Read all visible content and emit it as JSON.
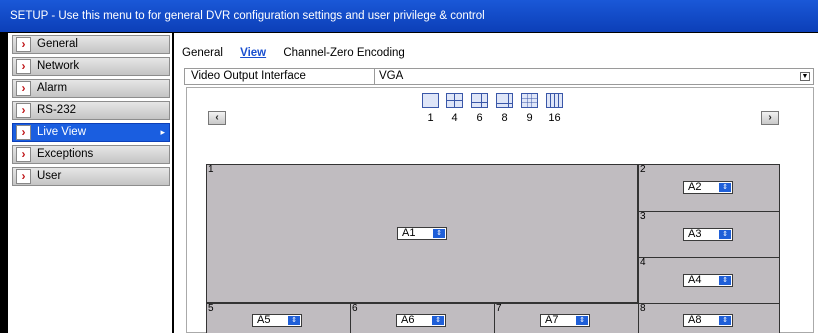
{
  "title": "SETUP - Use this menu to for general DVR configuration settings and user privilege & control",
  "sidebar": {
    "items": [
      {
        "label": "General"
      },
      {
        "label": "Network"
      },
      {
        "label": "Alarm"
      },
      {
        "label": "RS-232"
      },
      {
        "label": "Live View"
      },
      {
        "label": "Exceptions"
      },
      {
        "label": "User"
      }
    ],
    "active": "Live View"
  },
  "tabs": [
    {
      "label": "General"
    },
    {
      "label": "View"
    },
    {
      "label": "Channel-Zero Encoding"
    }
  ],
  "active_tab": "View",
  "video_output": {
    "label": "Video Output Interface",
    "value": "VGA"
  },
  "layouts": [
    "1",
    "4",
    "6",
    "8",
    "9",
    "16"
  ],
  "cells": [
    {
      "num": "1",
      "channel": "A1"
    },
    {
      "num": "2",
      "channel": "A2"
    },
    {
      "num": "3",
      "channel": "A3"
    },
    {
      "num": "4",
      "channel": "A4"
    },
    {
      "num": "5",
      "channel": "A5"
    },
    {
      "num": "6",
      "channel": "A6"
    },
    {
      "num": "7",
      "channel": "A7"
    },
    {
      "num": "8",
      "channel": "A8"
    }
  ],
  "colors": {
    "titlebar": "#1a58d8",
    "active_item": "#1a5ee0",
    "cell_bg": "#c0bcc0",
    "arrow": "#c0181b"
  }
}
